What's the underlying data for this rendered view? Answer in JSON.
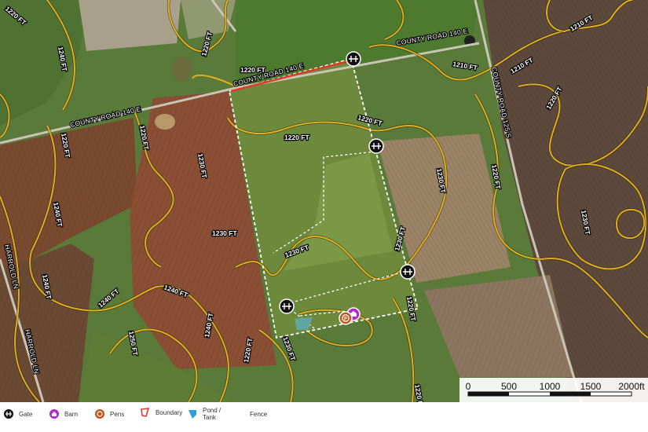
{
  "map": {
    "contour_labels": [
      "1220 FT",
      "1210 FT",
      "1230 FT",
      "1240 FT",
      "1250 FT"
    ],
    "roads": {
      "county_road_140e": "COUNTY ROAD 140 E",
      "county_road_125s": "COUNTY ROAD 125 S",
      "harrold_ln": "HARROLD LN"
    }
  },
  "scale": {
    "ticks": [
      "0",
      "500",
      "1000",
      "1500",
      "2000ft"
    ]
  },
  "legend": {
    "items": [
      {
        "label": "Gate",
        "icon": "gate-icon"
      },
      {
        "label": "Barn",
        "icon": "barn-icon"
      },
      {
        "label": "Pens",
        "icon": "pens-icon"
      },
      {
        "label": "Boundary",
        "icon": "boundary-icon"
      },
      {
        "label": "Pond / Tank",
        "icon": "pond-icon"
      },
      {
        "label": "Fence",
        "icon": "fence-icon"
      }
    ]
  },
  "colors": {
    "contour": "#e0b020",
    "boundary_highlight": "#e03a2a",
    "barn": "#b02cc8",
    "pens": "#c0541a",
    "pond": "#2ea0d8"
  }
}
